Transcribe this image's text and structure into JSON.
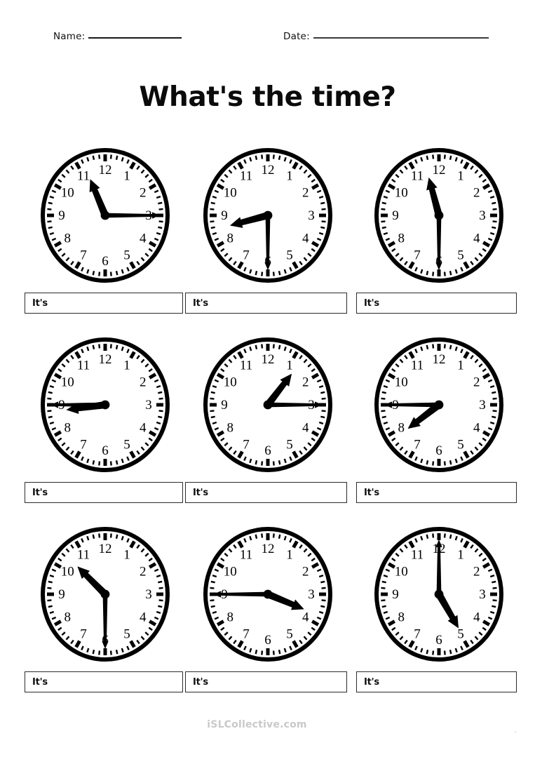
{
  "worksheet": {
    "title": "What's the time?",
    "name_label": "Name:",
    "date_label": "Date:",
    "answer_prefix": "It's",
    "watermark": "iSLCollective.com",
    "watermark_dot": "."
  },
  "clock_face": {
    "numerals": [
      "12",
      "1",
      "2",
      "3",
      "4",
      "5",
      "6",
      "7",
      "8",
      "9",
      "10",
      "11"
    ]
  },
  "clocks": [
    {
      "index": 1,
      "row": 1,
      "col": 1,
      "hour": 11,
      "minute": 15,
      "hour_angle": 337.5,
      "minute_angle": 90,
      "answer_prefix": "It's"
    },
    {
      "index": 2,
      "row": 1,
      "col": 2,
      "hour": 8,
      "minute": 30,
      "hour_angle": 255,
      "minute_angle": 180,
      "answer_prefix": "It's"
    },
    {
      "index": 3,
      "row": 1,
      "col": 3,
      "hour": 11,
      "minute": 30,
      "hour_angle": 345,
      "minute_angle": 180,
      "answer_prefix": "It's"
    },
    {
      "index": 4,
      "row": 2,
      "col": 1,
      "hour": 8,
      "minute": 45,
      "hour_angle": 262.5,
      "minute_angle": 270,
      "answer_prefix": "It's"
    },
    {
      "index": 5,
      "row": 2,
      "col": 2,
      "hour": 1,
      "minute": 15,
      "hour_angle": 37.5,
      "minute_angle": 90,
      "answer_prefix": "It's"
    },
    {
      "index": 6,
      "row": 2,
      "col": 3,
      "hour": 7,
      "minute": 45,
      "hour_angle": 232.5,
      "minute_angle": 270,
      "answer_prefix": "It's"
    },
    {
      "index": 7,
      "row": 3,
      "col": 1,
      "hour": 10,
      "minute": 30,
      "hour_angle": 315,
      "minute_angle": 180,
      "answer_prefix": "It's"
    },
    {
      "index": 8,
      "row": 3,
      "col": 2,
      "hour": 3,
      "minute": 45,
      "hour_angle": 112.5,
      "minute_angle": 270,
      "answer_prefix": "It's"
    },
    {
      "index": 9,
      "row": 3,
      "col": 3,
      "hour": 5,
      "minute": 0,
      "hour_angle": 150,
      "minute_angle": 0,
      "answer_prefix": "It's"
    }
  ]
}
